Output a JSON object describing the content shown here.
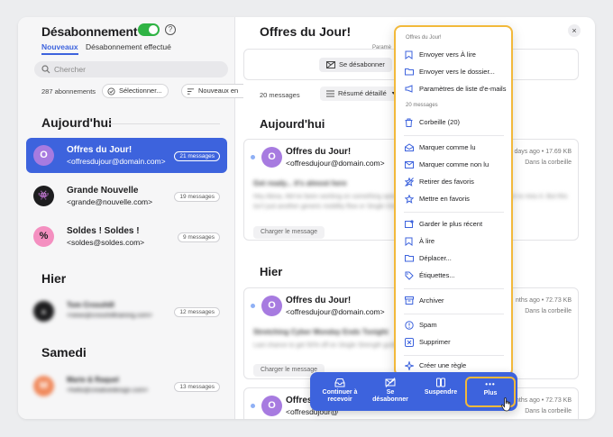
{
  "sidebar": {
    "title": "Désabonnement",
    "help": "?",
    "tabs": [
      "Nouveaux",
      "Désabonnement effectué"
    ],
    "search_placeholder": "Chercher",
    "count": "287 abonnements",
    "select_btn": "Sélectionner...",
    "newest_btn": "Nouveaux en",
    "groups": [
      "Aujourd'hui",
      "Hier",
      "Samedi"
    ],
    "senders": [
      {
        "name": "Offres du Jour!",
        "email": "<offresdujour@domain.com>",
        "badge": "21 messages",
        "initial": "O"
      },
      {
        "name": "Grande Nouvelle",
        "email": "<grande@nouvelle.com>",
        "badge": "19 messages",
        "initial": "👾"
      },
      {
        "name": "Soldes ! Soldes !",
        "email": "<soldes@soldes.com>",
        "badge": "9 messages",
        "initial": "%"
      },
      {
        "name": "Tom Crosshill",
        "email": "<news@crosshilltraining.com>",
        "badge": "12 messages",
        "initial": "▲"
      },
      {
        "name": "Marie & Raquel",
        "email": "<hello@creativedesign.com>",
        "badge": "13 messages",
        "initial": "M"
      }
    ]
  },
  "main": {
    "title": "Offres du Jour!",
    "close": "×",
    "params": "Paramè",
    "unsubscribe": "Se désabonner",
    "msg_count": "20 messages",
    "view": "Résumé détaillé",
    "groups": [
      "Aujourd'hui",
      "Hier"
    ],
    "messages": [
      {
        "from": "Offres du Jour!",
        "email": "<offresdujour@domain.com>",
        "meta1": "days ago  •  17.69 KB",
        "meta2": "Dans la corbeille",
        "subject": "Get ready... it's almost here",
        "body": "Hey Alexa, We've been working on something special just for you. And trust us, you don't want to miss it. But this isn't just another generic mobility flow or Single Direct.",
        "chip": "Charger le message",
        "initial": "O"
      },
      {
        "from": "Offres du Jour!",
        "email": "<offresdujour@domain.com>",
        "meta1": "nths ago  •  72.73 KB",
        "meta2": "Dans la corbeille",
        "subject": "Stretching Cyber Monday Ends Tonight",
        "body": "Last chance to get 50% off on Single Strength guide until midnight.",
        "chip": "Charger le message",
        "initial": "O"
      },
      {
        "from": "Offres",
        "email": "<offresdujour@",
        "meta1": "nths ago  •  72.73 KB",
        "meta2": "Dans la corbeille",
        "initial": "O"
      }
    ]
  },
  "menu": {
    "header": "Offres du Jour!",
    "items_a": [
      "Envoyer vers À lire",
      "Envoyer vers le dossier...",
      "Paramètres de liste d'e-mails"
    ],
    "header2": "20 messages",
    "trash": "Corbeille (20)",
    "items_b": [
      "Marquer comme lu",
      "Marquer comme non lu",
      "Retirer des favoris",
      "Mettre en favoris"
    ],
    "items_c": [
      "Garder le plus récent",
      "À lire",
      "Déplacer...",
      "Étiquettes..."
    ],
    "archive": "Archiver",
    "items_d": [
      "Spam",
      "Supprimer"
    ],
    "rule": "Créer une règle"
  },
  "actionbar": {
    "continue": [
      "Continuer à",
      "recevoir"
    ],
    "unsub": [
      "Se",
      "désabonner"
    ],
    "suspend": "Suspendre",
    "more_icon": "•••",
    "more": "Plus"
  },
  "colors": {
    "accent": "#3D63DD",
    "highlight": "#F2B93B",
    "toggle": "#2FB344"
  }
}
